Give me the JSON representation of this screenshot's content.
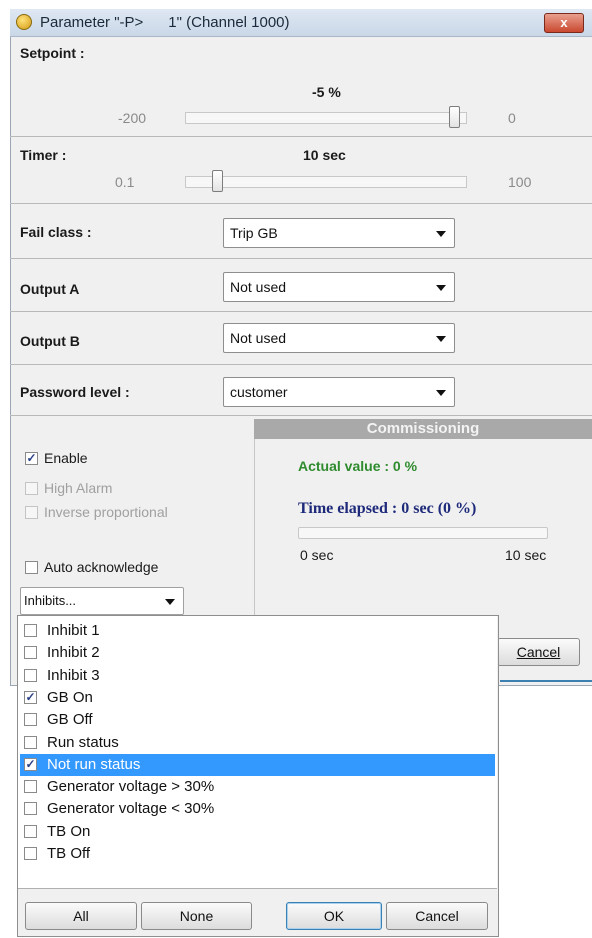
{
  "window": {
    "title": "Parameter \"-P>      1\" (Channel 1000)",
    "close_label": "x"
  },
  "setpoint": {
    "label": "Setpoint :",
    "value": "-5 %",
    "min": "-200",
    "max": "0",
    "level": 0.975
  },
  "timer": {
    "label": "Timer :",
    "value": "10 sec",
    "min": "0.1",
    "max": "100",
    "level": 0.1
  },
  "fail_class": {
    "label": "Fail class :",
    "value": "Trip GB"
  },
  "output_a": {
    "label": "Output A",
    "value": "Not used"
  },
  "output_b": {
    "label": "Output B",
    "value": "Not used"
  },
  "password_level": {
    "label": "Password level :",
    "value": "customer"
  },
  "options": {
    "enable": {
      "label": "Enable",
      "checked": true
    },
    "high_alarm": {
      "label": "High Alarm",
      "checked": false,
      "disabled": true
    },
    "inverse_proportional": {
      "label": "Inverse proportional",
      "checked": false,
      "disabled": true
    },
    "auto_acknowledge": {
      "label": "Auto acknowledge",
      "checked": false
    }
  },
  "inhibits_select": {
    "value": "Inhibits..."
  },
  "commissioning": {
    "header": "Commissioning",
    "actual_value": "Actual value : 0 %",
    "time_elapsed": "Time elapsed : 0 sec (0 %)",
    "progress": 0,
    "start_label": "0 sec",
    "end_label": "10 sec"
  },
  "dialog_buttons": {
    "cancel": "Cancel"
  },
  "inhibits_list": {
    "items": [
      {
        "label": "Inhibit 1",
        "checked": false,
        "selected": false
      },
      {
        "label": "Inhibit 2",
        "checked": false,
        "selected": false
      },
      {
        "label": "Inhibit 3",
        "checked": false,
        "selected": false
      },
      {
        "label": "GB On",
        "checked": true,
        "selected": false
      },
      {
        "label": "GB Off",
        "checked": false,
        "selected": false
      },
      {
        "label": "Run status",
        "checked": false,
        "selected": false
      },
      {
        "label": "Not run status",
        "checked": true,
        "selected": true
      },
      {
        "label": "Generator voltage > 30%",
        "checked": false,
        "selected": false
      },
      {
        "label": "Generator voltage < 30%",
        "checked": false,
        "selected": false
      },
      {
        "label": "TB On",
        "checked": false,
        "selected": false
      },
      {
        "label": "TB Off",
        "checked": false,
        "selected": false
      }
    ],
    "buttons": {
      "all": "All",
      "none": "None",
      "ok": "OK",
      "cancel": "Cancel"
    }
  },
  "colors": {
    "accent_green": "#2e8b2e",
    "accent_navy": "#1e2a7a",
    "selection": "#3399ff",
    "commissioning_header": "#a9a9a9"
  },
  "icons": {
    "title": "parameter-icon",
    "close": "close-icon",
    "dropdown": "chevron-down-icon",
    "check": "checkmark-icon"
  }
}
